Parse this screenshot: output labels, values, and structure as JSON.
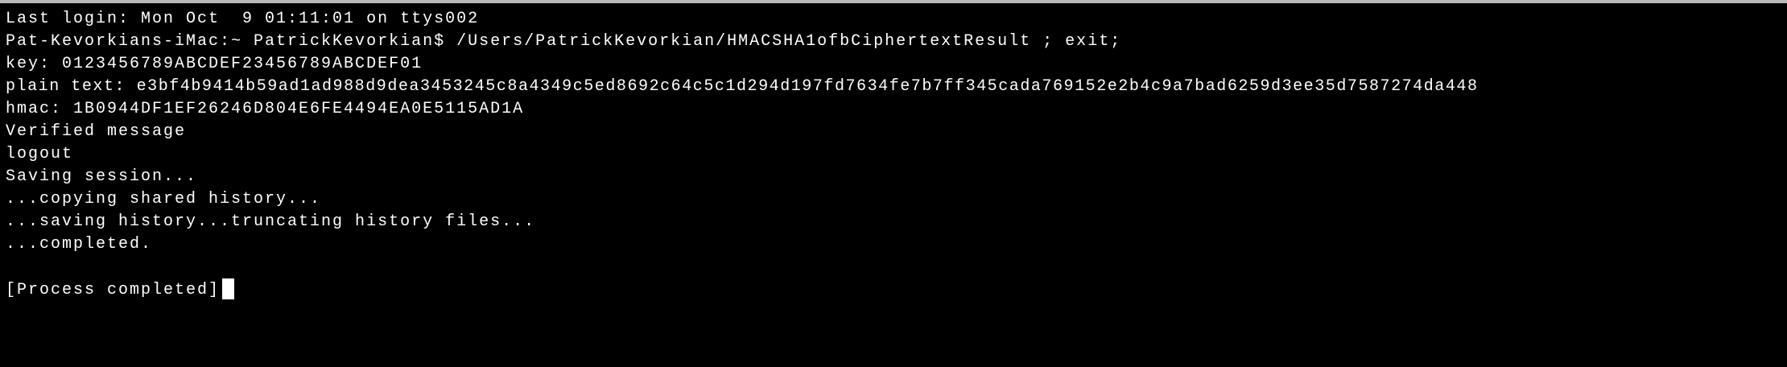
{
  "terminal": {
    "lines": [
      "Last login: Mon Oct  9 01:11:01 on ttys002",
      "Pat-Kevorkians-iMac:~ PatrickKevorkian$ /Users/PatrickKevorkian/HMACSHA1ofbCiphertextResult ; exit;",
      "key: 0123456789ABCDEF23456789ABCDEF01",
      "plain text: e3bf4b9414b59ad1ad988d9dea3453245c8a4349c5ed8692c64c5c1d294d197fd7634fe7b7ff345cada769152e2b4c9a7bad6259d3ee35d7587274da448",
      "hmac: 1B0944DF1EF26246D804E6FE4494EA0E5115AD1A",
      "Verified message",
      "logout",
      "Saving session...",
      "...copying shared history...",
      "...saving history...truncating history files...",
      "...completed.",
      "",
      "[Process completed]"
    ],
    "background_color": "#000000",
    "text_color": "#ffffff",
    "cursor_icon": "block-cursor"
  }
}
